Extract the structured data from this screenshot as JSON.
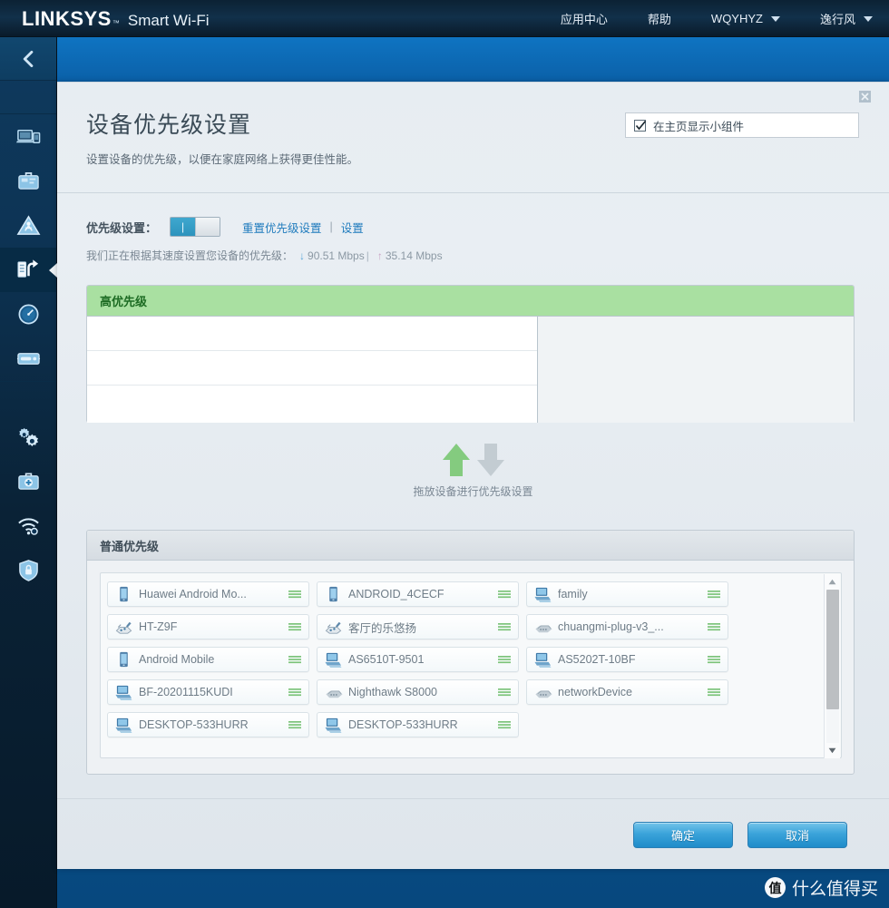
{
  "header": {
    "brand_main": "LINKSYS",
    "brand_tm": "™",
    "brand_sub": "Smart Wi-Fi",
    "nav": [
      {
        "label": "应用中心",
        "caret": false,
        "name": "nav-app-center"
      },
      {
        "label": "帮助",
        "caret": false,
        "name": "nav-help"
      },
      {
        "label": "WQYHYZ",
        "caret": true,
        "name": "nav-network"
      },
      {
        "label": "逸行风",
        "caret": true,
        "name": "nav-account"
      }
    ]
  },
  "sidebar": {
    "back_icon": "chevron-left-icon",
    "items": [
      {
        "icon": "devices-icon",
        "name": "sidebar-item-device-list"
      },
      {
        "icon": "parental-controls-icon",
        "name": "sidebar-item-parental-controls"
      },
      {
        "icon": "guest-access-warning-icon",
        "name": "sidebar-item-guest-access"
      },
      {
        "icon": "media-prioritization-icon",
        "name": "sidebar-item-media-prioritization",
        "active": true
      },
      {
        "icon": "speed-test-gauge-icon",
        "name": "sidebar-item-speed-test"
      },
      {
        "icon": "external-storage-icon",
        "name": "sidebar-item-external-storage"
      }
    ],
    "items_lower": [
      {
        "icon": "gears-icon",
        "name": "sidebar-item-connectivity"
      },
      {
        "icon": "troubleshooting-kit-icon",
        "name": "sidebar-item-troubleshooting"
      },
      {
        "icon": "wifi-settings-icon",
        "name": "sidebar-item-wireless"
      },
      {
        "icon": "shield-lock-icon",
        "name": "sidebar-item-security"
      }
    ]
  },
  "dialog": {
    "title": "设备优先级设置",
    "subtitle": "设置设备的优先级，以便在家庭网络上获得更佳性能。",
    "close_icon": "close-icon",
    "widget_checkbox": {
      "label": "在主页显示小组件",
      "checked": true,
      "check_icon": "checkmark-icon"
    },
    "priority": {
      "label": "优先级设置：",
      "toggle_state": "on",
      "toggle_mark": "|",
      "reset_link": "重置优先级设置",
      "separator": "|",
      "settings_link": "设置"
    },
    "speed": {
      "prefix": "我们正在根据其速度设置您设备的优先级：",
      "down_icon": "arrow-down-icon",
      "download": "90.51 Mbps",
      "divider": "|",
      "up_icon": "arrow-up-icon",
      "upload": "35.14 Mbps"
    },
    "high_priority": {
      "title": "高优先级",
      "empty_slots": 3,
      "header_color": "#a9e0a1",
      "title_color": "#1d6b23"
    },
    "drag_hint": {
      "up_icon": "arrow-up-green-icon",
      "down_icon": "arrow-down-gray-icon",
      "text": "拖放设备进行优先级设置"
    },
    "normal_priority": {
      "title": "普通优先级",
      "devices": [
        {
          "name": "Huawei Android Mo...",
          "icon": "mobile-phone-icon"
        },
        {
          "name": "ANDROID_4CECF",
          "icon": "mobile-phone-icon"
        },
        {
          "name": "family",
          "icon": "computer-icon"
        },
        {
          "name": "HT-Z9F",
          "icon": "generic-device-icon"
        },
        {
          "name": "客厅的乐悠扬",
          "icon": "generic-device-icon"
        },
        {
          "name": "chuangmi-plug-v3_...",
          "icon": "network-switch-icon"
        },
        {
          "name": "Android Mobile",
          "icon": "mobile-phone-icon"
        },
        {
          "name": "AS6510T-9501",
          "icon": "computer-icon"
        },
        {
          "name": "AS5202T-10BF",
          "icon": "computer-icon"
        },
        {
          "name": "BF-20201115KUDI",
          "icon": "computer-icon"
        },
        {
          "name": "Nighthawk S8000",
          "icon": "network-switch-icon"
        },
        {
          "name": "networkDevice",
          "icon": "network-switch-icon"
        },
        {
          "name": "DESKTOP-533HURR",
          "icon": "computer-icon"
        },
        {
          "name": "DESKTOP-533HURR",
          "icon": "computer-icon"
        }
      ],
      "scrollbar": {
        "up_icon": "scroll-up-icon",
        "down_icon": "scroll-down-icon"
      },
      "grip_icon": "drag-grip-icon",
      "grip_color": "#7cc47a"
    },
    "footer": {
      "ok_label": "确定",
      "cancel_label": "取消"
    }
  },
  "watermark": {
    "badge": "值",
    "text": "什么值得买"
  },
  "colors": {
    "brand_blue": "#0a63ac",
    "accent_link": "#1f7bbd",
    "high_priority_green": "#a9e0a1",
    "button_blue": "#2a97d0"
  }
}
